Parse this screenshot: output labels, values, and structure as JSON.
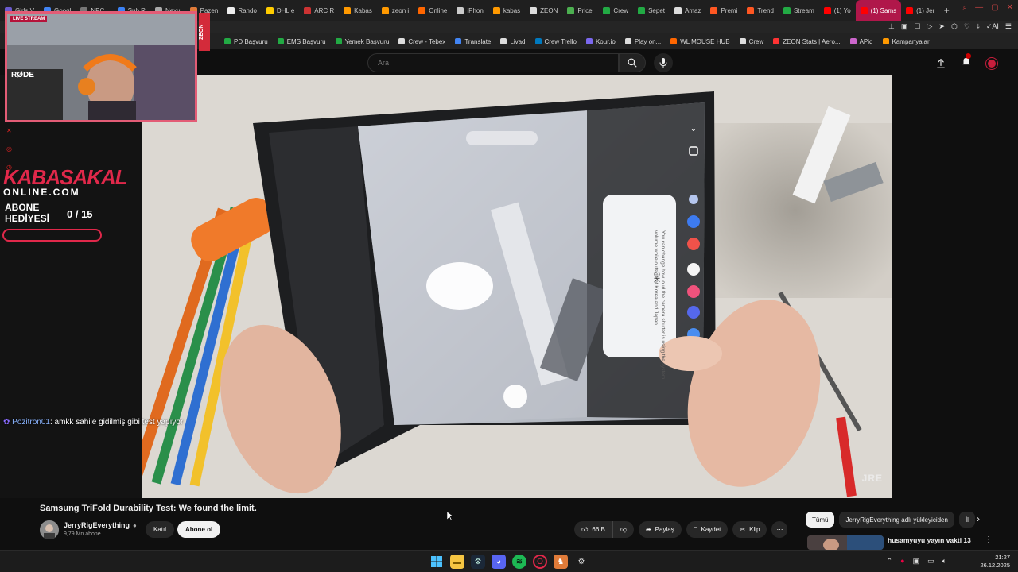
{
  "browser": {
    "tabs": [
      {
        "label": "Girls V",
        "color": "#6a5acd"
      },
      {
        "label": "Googl",
        "color": "#4285f4"
      },
      {
        "label": "NPC I",
        "color": "#777777"
      },
      {
        "label": "Sub R",
        "color": "#3b82f6"
      },
      {
        "label": "Nexu",
        "color": "#aaaaaa"
      },
      {
        "label": "Pazen",
        "color": "#e07b39"
      },
      {
        "label": "Rando",
        "color": "#eeeeee"
      },
      {
        "label": "DHL e",
        "color": "#ffcc00"
      },
      {
        "label": "ARC R",
        "color": "#cc3333"
      },
      {
        "label": "Kabas",
        "color": "#ff9900"
      },
      {
        "label": "zeon i",
        "color": "#ff9900"
      },
      {
        "label": "Online",
        "color": "#ff6600"
      },
      {
        "label": "iPhon",
        "color": "#cccccc"
      },
      {
        "label": "kabas",
        "color": "#ff9900"
      },
      {
        "label": "ZEON",
        "color": "#dddddd"
      },
      {
        "label": "Pricei",
        "color": "#4caf50"
      },
      {
        "label": "Crew",
        "color": "#22aa44"
      },
      {
        "label": "Sepet",
        "color": "#22aa44"
      },
      {
        "label": "Amaz",
        "color": "#dddddd"
      },
      {
        "label": "Premi",
        "color": "#ff5722"
      },
      {
        "label": "Trend",
        "color": "#ff5722"
      },
      {
        "label": "Stream",
        "color": "#22aa44"
      },
      {
        "label": "(1) Yo",
        "color": "#ff0000"
      },
      {
        "label": "(1) Sams",
        "color": "#ff0000",
        "active": true
      },
      {
        "label": "(1) Jer",
        "color": "#ff0000"
      }
    ],
    "new_tab_symbol": "+",
    "bookmarks": [
      {
        "label": "PD Başvuru",
        "color": "#22aa44"
      },
      {
        "label": "EMS Başvuru",
        "color": "#22aa44"
      },
      {
        "label": "Yemek Başvuru",
        "color": "#22aa44"
      },
      {
        "label": "Crew - Tebex",
        "color": "#dddddd"
      },
      {
        "label": "Translate",
        "color": "#4285f4"
      },
      {
        "label": "Livad",
        "color": "#dddddd"
      },
      {
        "label": "Crew Trello",
        "color": "#0079bf"
      },
      {
        "label": "Kour.io",
        "color": "#7b68ee"
      },
      {
        "label": "Play on...",
        "color": "#dddddd"
      },
      {
        "label": "WL MOUSE HUB",
        "color": "#ff6600"
      },
      {
        "label": "Crew",
        "color": "#dddddd"
      },
      {
        "label": "ZEON Stats | Aero...",
        "color": "#ff3333"
      },
      {
        "label": "APiq",
        "color": "#cc66cc"
      },
      {
        "label": "Kampanyalar",
        "color": "#ff9900"
      }
    ]
  },
  "youtube": {
    "search_placeholder": "Ara",
    "video_watermark": "JRE",
    "video_title": "Samsung TriFold Durability Test: We found the limit.",
    "channel_name": "JerryRigEverything",
    "channel_subs": "9,79 Mn abone",
    "join_label": "Katıl",
    "subscribe_label": "Abone ol",
    "like_count": "66 B",
    "share_label": "Paylaş",
    "save_label": "Kaydet",
    "clip_label": "Klip",
    "chips": [
      "Tümü",
      "JerryRigEverything adlı yükleyiciden",
      "İl"
    ],
    "recommended_title": "husamyuyu yayın vakti 13"
  },
  "stream_overlay": {
    "live_tag": "LIVE STREAM",
    "zeon_tag": "ZEON",
    "brand_line1": "KABASAKAL",
    "brand_line2": "ONLINE.COM",
    "sub_goal_label_1": "ABONE",
    "sub_goal_label_2": "HEDİYESİ",
    "sub_goal_count": "0 / 15",
    "sub_goal_progress": 0,
    "chat_user": "Pozitron01",
    "chat_text": ": amkk sahile gidilmiş gibi test yapıyor"
  },
  "video_popup": {
    "message": "You can change how loud the camera shutter is using the system volume while outside of Korea and Japan.",
    "ok": "OK"
  },
  "taskbar": {
    "time": "21:27",
    "date": "26.12.2025"
  }
}
